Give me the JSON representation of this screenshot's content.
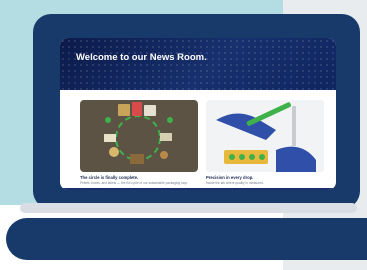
{
  "hero": {
    "title": "Welcome to our News Room."
  },
  "cards": [
    {
      "title": "The circle is finally complete.",
      "text": "Pellets, boxes, and labels — the full cycle of our sustainable packaging loop."
    },
    {
      "title": "Precision in every drop.",
      "text": "Inside the lab where quality is measured."
    }
  ],
  "colors": {
    "laptop": "#173a6b",
    "hero": "#0f2560",
    "accent_green": "#3fb14a"
  }
}
